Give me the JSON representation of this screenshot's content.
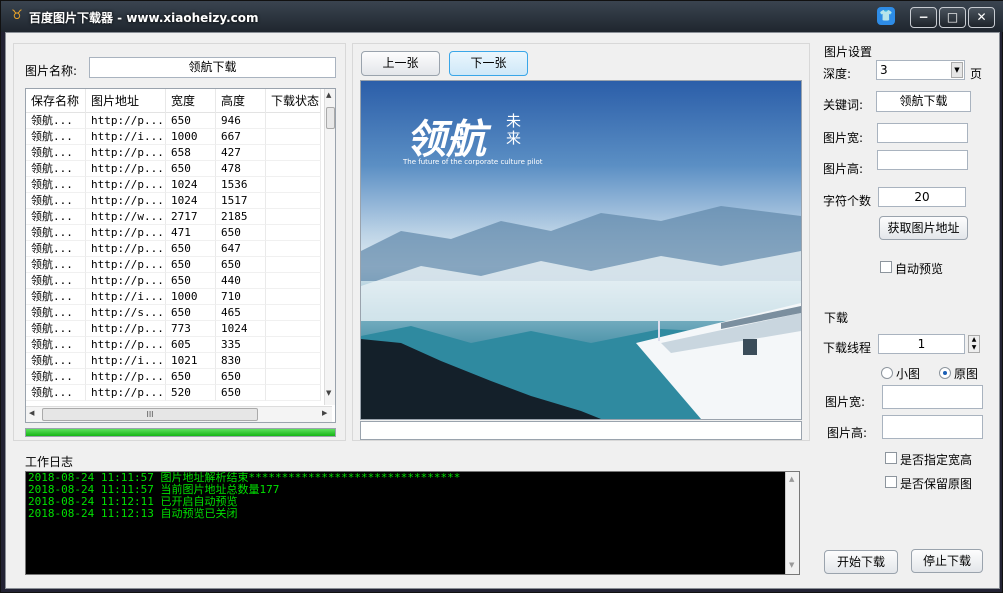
{
  "window": {
    "title": "百度图片下载器 - www.xiaoheizy.com"
  },
  "left": {
    "name_label": "图片名称:",
    "name_value": "领航下载",
    "columns": [
      "保存名称",
      "图片地址",
      "宽度",
      "高度",
      "下载状态"
    ],
    "rows": [
      [
        "领航...",
        "http://p...",
        "650",
        "946",
        ""
      ],
      [
        "领航...",
        "http://i...",
        "1000",
        "667",
        ""
      ],
      [
        "领航...",
        "http://p...",
        "658",
        "427",
        ""
      ],
      [
        "领航...",
        "http://p...",
        "650",
        "478",
        ""
      ],
      [
        "领航...",
        "http://p...",
        "1024",
        "1536",
        ""
      ],
      [
        "领航...",
        "http://p...",
        "1024",
        "1517",
        ""
      ],
      [
        "领航...",
        "http://w...",
        "2717",
        "2185",
        ""
      ],
      [
        "领航...",
        "http://p...",
        "471",
        "650",
        ""
      ],
      [
        "领航...",
        "http://p...",
        "650",
        "647",
        ""
      ],
      [
        "领航...",
        "http://p...",
        "650",
        "650",
        ""
      ],
      [
        "领航...",
        "http://p...",
        "650",
        "440",
        ""
      ],
      [
        "领航...",
        "http://i...",
        "1000",
        "710",
        ""
      ],
      [
        "领航...",
        "http://s...",
        "650",
        "465",
        ""
      ],
      [
        "领航...",
        "http://p...",
        "773",
        "1024",
        ""
      ],
      [
        "领航...",
        "http://p...",
        "605",
        "335",
        ""
      ],
      [
        "领航...",
        "http://i...",
        "1021",
        "830",
        ""
      ],
      [
        "领航...",
        "http://p...",
        "650",
        "650",
        ""
      ],
      [
        "领航...",
        "http://p...",
        "520",
        "650",
        ""
      ]
    ],
    "progress": 1.0,
    "hscroll_glyph": "III"
  },
  "preview": {
    "prev_label": "上一张",
    "next_label": "下一张",
    "logo_big": "领航",
    "logo_small_1": "未",
    "logo_small_2": "来",
    "tagline": "The future of the corporate culture pilot"
  },
  "log": {
    "title": "工作日志",
    "lines": [
      "2018-08-24 11:11:57 图片地址解析结束********************************",
      "2018-08-24 11:11:57 当前图片地址总数量177",
      "2018-08-24 11:12:11 已开启自动预览",
      "2018-08-24 11:12:13 自动预览已关闭"
    ]
  },
  "settings": {
    "title": "图片设置",
    "depth_label": "深度:",
    "depth_value": "3",
    "depth_unit": "页",
    "keyword_label": "关键词:",
    "keyword_value": "领航下载",
    "width_label": "图片宽:",
    "width_value": "",
    "height_label": "图片高:",
    "height_value": "",
    "chars_label": "字符个数",
    "chars_value": "20",
    "fetch_button": "获取图片地址",
    "auto_preview_label": "自动预览",
    "auto_preview_checked": false
  },
  "download": {
    "title": "下载",
    "threads_label": "下载线程",
    "threads_value": "1",
    "small_label": "小图",
    "original_label": "原图",
    "selected": "原图",
    "width_label": "图片宽:",
    "width_value": "",
    "height_label": "图片高:",
    "height_value": "",
    "specify_size_label": "是否指定宽高",
    "keep_original_label": "是否保留原图",
    "start_button": "开始下载",
    "stop_button": "停止下载"
  }
}
